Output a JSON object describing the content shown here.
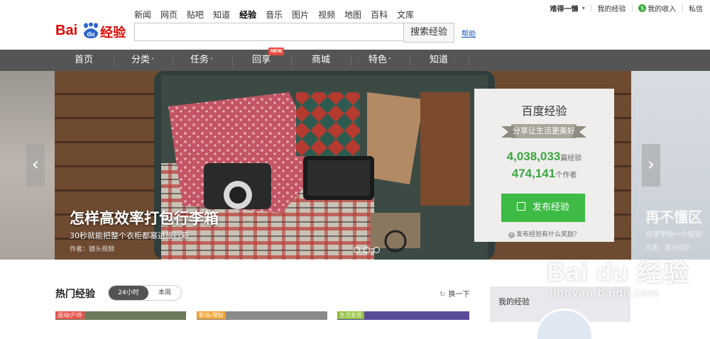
{
  "logo": {
    "bai": "Bai",
    "du": "du",
    "jingyan": "经验"
  },
  "topnav": [
    "新闻",
    "网页",
    "贴吧",
    "知道",
    "经验",
    "音乐",
    "图片",
    "视频",
    "地图",
    "百科",
    "文库"
  ],
  "topnav_active": "经验",
  "search": {
    "value": "",
    "placeholder": "",
    "button": "搜索经验",
    "help": "帮助"
  },
  "userbar": {
    "username": "难得一懒",
    "my_experience": "我的经验",
    "my_income": "我的收入",
    "messages": "私信"
  },
  "mainnav": {
    "items": [
      "首页",
      "分类",
      "任务",
      "回享",
      "商城",
      "特色",
      "知道"
    ],
    "new_badge": "NEW"
  },
  "banner": {
    "title": "怎样高效率打包行李箱",
    "subtitle": "30秒就能把整个衣柜都塞进旅行箱",
    "author": "作者：镜头视频",
    "right_title": "再不懂区",
    "right_sub": "与李学师一个知识",
    "right_author": "作者：春光灿烂"
  },
  "panel": {
    "title": "百度经验",
    "slogan": "分享让生活更美好",
    "count_articles": "4,038,033",
    "unit_articles": "篇经验",
    "count_authors": "474,141",
    "unit_authors": "个作者",
    "publish": "发布经验",
    "reward_question": "发布经验有什么奖励？"
  },
  "hot": {
    "title": "热门经验",
    "tab_active": "24小时",
    "tab_other": "本周",
    "refresh": "换一下",
    "card_tags": [
      "运动/户外",
      "职场/理财",
      "生活家居"
    ]
  },
  "my_experience_box": {
    "label": "我的经验"
  },
  "watermark": {
    "line1": "Bai du 经验",
    "line2": "jingyan.baidu.com"
  },
  "colors": {
    "brand_red": "#e10601",
    "nav_bg": "#555555",
    "accent_green": "#3dbb45",
    "stat_green": "#3ba641"
  }
}
